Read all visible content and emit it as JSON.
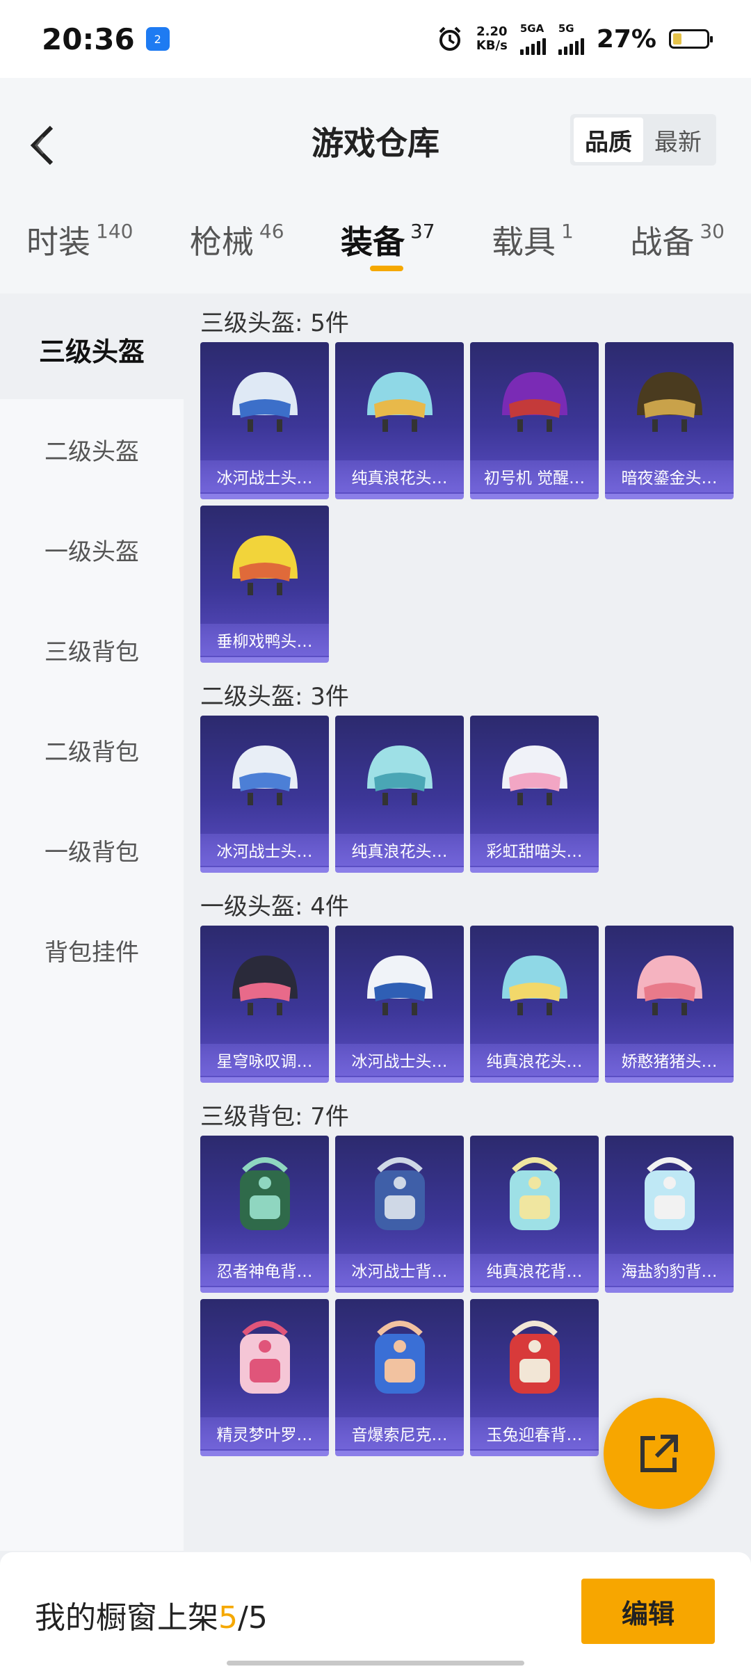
{
  "status": {
    "time": "20:36",
    "nfc": "2",
    "speed_top": "2.20",
    "speed_unit": "KB/s",
    "sig1": "5GA",
    "sig2": "5G",
    "battery_pct": "27%",
    "battery_level": 0.27
  },
  "header": {
    "title": "游戏仓库",
    "sort_quality": "品质",
    "sort_newest": "最新"
  },
  "tabs": [
    {
      "label": "时装",
      "count": "140"
    },
    {
      "label": "枪械",
      "count": "46"
    },
    {
      "label": "装备",
      "count": "37"
    },
    {
      "label": "载具",
      "count": "1"
    },
    {
      "label": "战备",
      "count": "30"
    }
  ],
  "sidebar": [
    {
      "label": "三级头盔"
    },
    {
      "label": "二级头盔"
    },
    {
      "label": "一级头盔"
    },
    {
      "label": "三级背包"
    },
    {
      "label": "二级背包"
    },
    {
      "label": "一级背包"
    },
    {
      "label": "背包挂件"
    }
  ],
  "sections": [
    {
      "title": "三级头盔: 5件",
      "items": [
        "冰河战士头…",
        "纯真浪花头…",
        "初号机 觉醒…",
        "暗夜鎏金头…",
        "垂柳戏鸭头…"
      ]
    },
    {
      "title": "二级头盔: 3件",
      "items": [
        "冰河战士头…",
        "纯真浪花头…",
        "彩虹甜喵头…"
      ]
    },
    {
      "title": "一级头盔: 4件",
      "items": [
        "星穹咏叹调…",
        "冰河战士头…",
        "纯真浪花头…",
        "娇憨猪猪头…"
      ]
    },
    {
      "title": "三级背包: 7件",
      "items": [
        "忍者神龟背…",
        "冰河战士背…",
        "纯真浪花背…",
        "海盐豹豹背…",
        "精灵梦叶罗…",
        "音爆索尼克…",
        "玉兔迎春背…"
      ]
    }
  ],
  "bottom": {
    "shop_prefix": "我的橱窗上架",
    "shop_current": "5",
    "shop_sep": "/",
    "shop_total": "5",
    "edit_label": "编辑"
  }
}
